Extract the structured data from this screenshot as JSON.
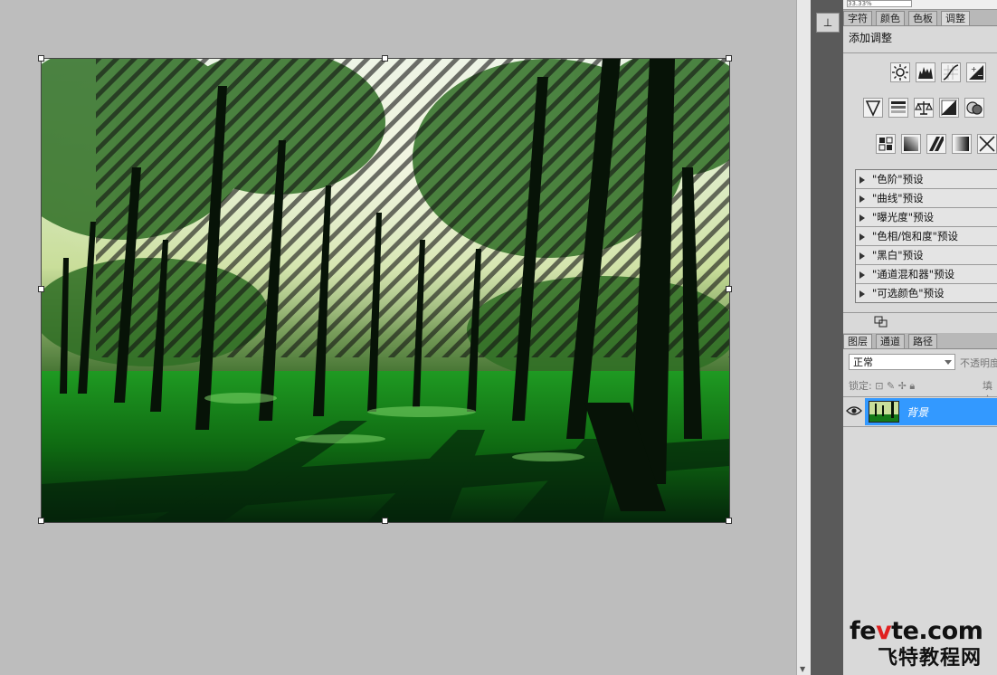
{
  "document": {
    "canvas_name": "forest-photo"
  },
  "top_field": {
    "zoom_text": "33.33%"
  },
  "panel_tabs": [
    {
      "label": "字符",
      "active": false
    },
    {
      "label": "颜色",
      "active": false
    },
    {
      "label": "色板",
      "active": false
    },
    {
      "label": "调整",
      "active": true
    }
  ],
  "adjustments": {
    "title": "添加调整",
    "row1_icons": [
      "brightness-icon",
      "levels-icon",
      "curves-icon",
      "exposure-icon"
    ],
    "row2_icons": [
      "vibrance-icon",
      "hue-saturation-icon",
      "color-balance-icon",
      "black-white-icon",
      "photo-filter-icon"
    ],
    "row3_icons": [
      "channel-mixer-icon",
      "invert-icon",
      "posterize-icon",
      "threshold-icon",
      "gradient-map-icon"
    ],
    "presets": [
      "\"色阶\"预设",
      "\"曲线\"预设",
      "\"曝光度\"预设",
      "\"色相/饱和度\"预设",
      "\"黑白\"预设",
      "\"通道混和器\"预设",
      "\"可选颜色\"预设"
    ]
  },
  "layers_tabs": [
    {
      "label": "图层",
      "active": true
    },
    {
      "label": "通道",
      "active": false
    },
    {
      "label": "路径",
      "active": false
    }
  ],
  "layers": {
    "blend_mode": "正常",
    "opacity_label": "不透明度:",
    "lock_label": "锁定:",
    "fill_label": "填充:",
    "items": [
      {
        "name": "背景",
        "visible": true,
        "selected": true
      }
    ]
  },
  "watermark": {
    "line1_a": "fe",
    "line1_b": "v",
    "line1_c": "te.com",
    "line2": "飞特教程网"
  },
  "colors": {
    "selection_blue": "#3399ff",
    "panel_bg": "#d9d9d9",
    "workspace_bg": "#bdbdbd"
  }
}
